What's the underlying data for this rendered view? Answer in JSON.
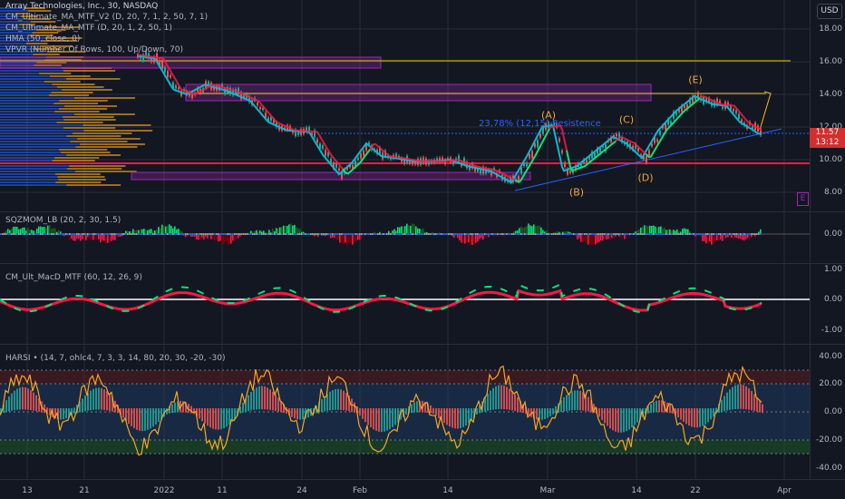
{
  "header": {
    "symbol_title": "Array Technologies, Inc., 30, NASDAQ",
    "currency": "USD"
  },
  "indicators_main": [
    "CM_Ultimate_MA_MTF_V2 (D, 20, 7, 1, 2, 50, 7, 1)",
    "CM_Ultimate_MA_MTF (D, 20, 1, 2, 50, 1)",
    "HMA (50, close, 0)",
    "VPVR (Number Of Rows, 100, Up/Down, 70)"
  ],
  "price_axis": [
    "18.00",
    "16.00",
    "14.00",
    "12.00",
    "10.00",
    "8.00"
  ],
  "last_price": {
    "value": "11.57",
    "countdown": "13:12"
  },
  "annotations": {
    "resistance": "23,78% (12,15) Resistence",
    "waves": [
      "(A)",
      "(B)",
      "(C)",
      "(D)",
      "(E)"
    ],
    "e_marker": "E"
  },
  "sqz": {
    "label": "SQZMOM_LB (20, 2, 30, 1.5)",
    "axis": [
      "0.00"
    ]
  },
  "macd": {
    "label": "CM_Ult_MacD_MTF (60, 12, 26, 9)",
    "axis": [
      "1.00",
      "0.00",
      "-1.00"
    ]
  },
  "harsi": {
    "label": "HARSI",
    "params": "(14, 7, ohlc4, 7, 3, 3, 14, 80, 20, 30, -20, -30)",
    "axis": [
      "40.00",
      "20.00",
      "0.00",
      "-20.00",
      "-40.00"
    ]
  },
  "time_axis": [
    "13",
    "21",
    "2022",
    "11",
    "24",
    "Feb",
    "14",
    "Mar",
    "14",
    "22",
    "Apr"
  ],
  "colors": {
    "bg": "#131722",
    "grid": "#2a2e39",
    "bull": "#26a69a",
    "bear": "#ef5350",
    "ma_green": "#00e676",
    "ma_red": "#ff1744",
    "hma": "#00bcd4",
    "vpvr_up": "#2962ff",
    "vpvr_down": "#f5a623",
    "value_area": "#9c27b0",
    "support": "#ff1744",
    "resistance_line": "#f0c419",
    "wave_label": "#f0a830",
    "harsi_line": "#f5a623"
  }
}
